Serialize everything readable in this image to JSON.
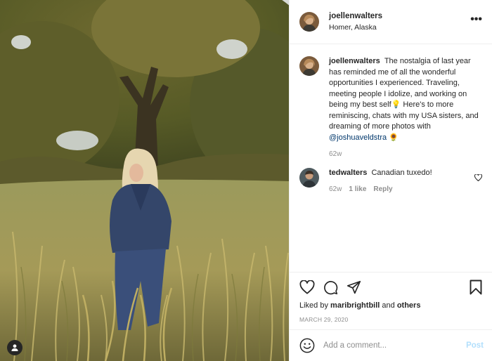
{
  "post": {
    "author": "joellenwalters",
    "location": "Homer, Alaska",
    "more_icon": "more-options-icon",
    "user_tag_icon": "user-tag-icon"
  },
  "caption": {
    "username": "joellenwalters",
    "text": "The nostalgia of last year has reminded me of all the wonderful opportunities I experienced. Traveling, meeting people I idolize, and working on being my best self",
    "emoji_1": "💡",
    "text_2": " Here's to more reminiscing, chats with my USA sisters, and dreaming of more photos with ",
    "mention": "@joshuaveldstra",
    "emoji_2": "🌻",
    "age": "62w"
  },
  "comments": [
    {
      "username": "tedwalters",
      "text": "Canadian tuxedo!",
      "age": "62w",
      "likes": "1 like",
      "reply": "Reply"
    }
  ],
  "engagement": {
    "liked_by_prefix": "Liked by",
    "liked_by_user": "maribrightbill",
    "and": "and",
    "others": "others",
    "date": "MARCH 29, 2020"
  },
  "comment_box": {
    "placeholder": "Add a comment...",
    "post_label": "Post"
  },
  "colors": {
    "text": "#262626",
    "muted": "#8e8e8e",
    "link": "#00376b",
    "post_disabled": "#b2dffc",
    "divider": "#efefef"
  }
}
